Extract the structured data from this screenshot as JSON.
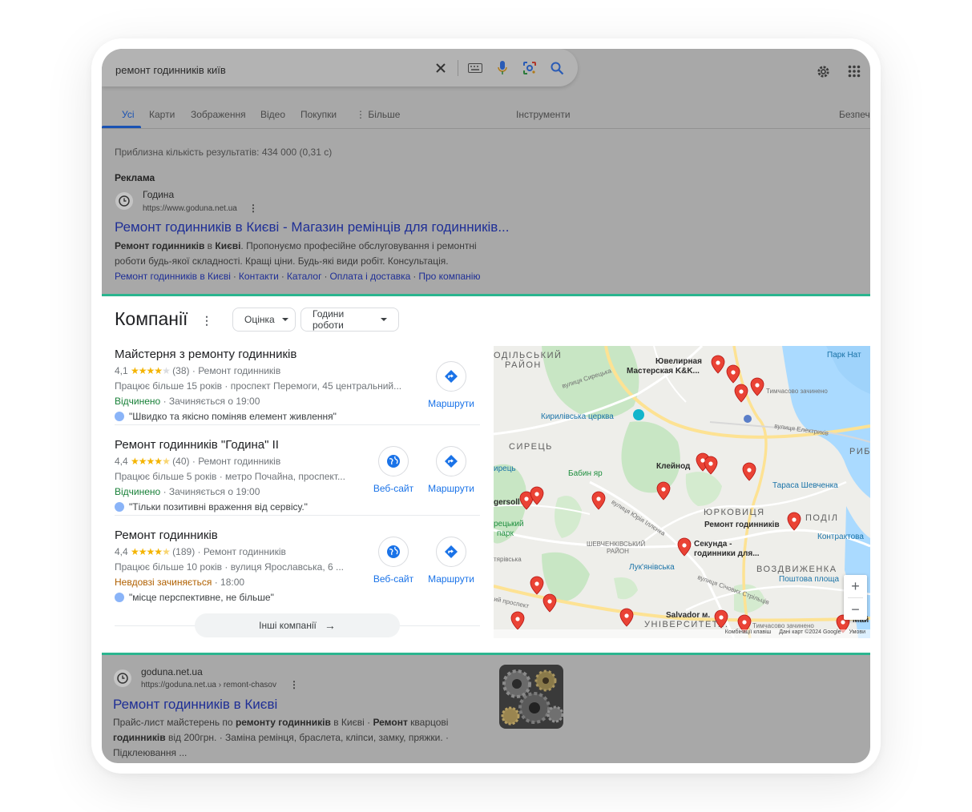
{
  "search": {
    "query": "ремонт годинників київ"
  },
  "tabs": [
    {
      "label": "Усі"
    },
    {
      "label": "Карти"
    },
    {
      "label": "Зображення"
    },
    {
      "label": "Відео"
    },
    {
      "label": "Покупки"
    },
    {
      "label": "Більше"
    },
    {
      "label": "Інструменти"
    },
    {
      "label": "Безпеч"
    }
  ],
  "result_stats": "Приблизна кількість результатів: 434 000 (0,31 с)",
  "ad": {
    "label": "Реклама",
    "site_name": "Година",
    "url": "https://www.goduna.net.ua",
    "title": "Ремонт годинників в Києві - Магазин ремінців для годинників...",
    "snippet_b1": "Ремонт годинників",
    "snippet_t1": " в ",
    "snippet_b2": "Києві",
    "snippet_t2": ". Пропонуємо професійне обслуговування і ремонтні",
    "snippet_line2": "роботи будь-якої складності. Кращі ціни. Будь-які види робіт. Консультація.",
    "sitelinks": [
      "Ремонт годинників в Києві",
      "Контакти",
      "Каталог",
      "Оплата і доставка",
      "Про компанію"
    ]
  },
  "companies": {
    "title": "Компанії",
    "filters": [
      "Оцінка",
      "Години роботи"
    ],
    "more_label": "Інші компанії",
    "items": [
      {
        "name": "Майстерня з ремонту годинників",
        "rating": "4,1",
        "stars_value": 4.1,
        "reviews": "(38)",
        "category": "Ремонт годинників",
        "details": "Працює більше 15 років · проспект Перемоги, 45 центральний...",
        "status": "Відчинено",
        "hours": " · Зачиняється о 19:00",
        "review": "\"Швидко та якісно поміняв елемент живлення\"",
        "website": "",
        "directions": "Маршрути"
      },
      {
        "name": "Ремонт годинників \"Година\" ІІ",
        "rating": "4,4",
        "stars_value": 4.4,
        "reviews": "(40)",
        "category": "Ремонт годинників",
        "details": "Працює більше 5 років · метро Почайна, проспект...",
        "status": "Відчинено",
        "hours": " · Зачиняється о 19:00",
        "review": "\"Тільки позитивні враження від сервісу.\"",
        "website": "Веб-сайт",
        "directions": "Маршрути"
      },
      {
        "name": "Ремонт годинників",
        "rating": "4,4",
        "stars_value": 4.4,
        "reviews": "(189)",
        "category": "Ремонт годинників",
        "details": "Працює більше 10 років · вулиця Ярославська, 6 ...",
        "status": "Невдовзі зачиняється",
        "hours": " · 18:00",
        "review": "\"місце перспективне, не більше\"",
        "website": "Веб-сайт",
        "directions": "Маршрути"
      }
    ]
  },
  "map": {
    "labels": {
      "podilskyi": "ОДІЛЬСЬКИЙ",
      "raion": "РАЙОН",
      "park_nat": "Парк Нат",
      "jewelry": "Ювелирная",
      "jewelry2": "Мастерская K&K...",
      "temp_closed": "Тимчасово зачинено",
      "kyrylivska": "Кирилівська церква",
      "vul_syretska": "вулиця Сирецька",
      "vul_elektrykiv": "вулиця Електриків",
      "syrets": "СИРЕЦЬ",
      "ryb": "РИБ",
      "babyn_yar": "Бабин яр",
      "kleinod": "Клейнод",
      "taras": "Тараса Шевченка",
      "yrets": "ирець",
      "gersoll": "gersoll",
      "yurkovytsia": "ЮРКОВИЦЯ",
      "podil": "ПОДІЛ",
      "remont": "Ремонт годинників",
      "kontraktova": "Контрактова",
      "park1": "рецький",
      "park2": "парк",
      "vul_yuriia": "вулиця Юрія Іллєнка",
      "shevchenkivskyi": "ШЕВЧЕНКІВСЬКИЙ",
      "raion2": "РАЙОН",
      "sekunda": "Секунда -",
      "sekunda2": "годинники для...",
      "tryivska": "тярівська",
      "lukianivska": "Лук'янівська",
      "vozdvyzhenka": "ВОЗДВИЖЕНКА",
      "poshtova": "Поштова площа",
      "prospekt": "ий проспект",
      "sichovykh": "вулиця Січових Стрільців",
      "salvador": "Salvador м.",
      "universytet": "УНІВЕРСИТЕТ...",
      "temp_closed2": "Тимчасово зачинено",
      "mai": "Май"
    },
    "footer": [
      "Комбінації клавіш",
      "Дані карт ©2024 Google",
      "Умови"
    ]
  },
  "organic": {
    "site_name": "goduna.net.ua",
    "url": "https://goduna.net.ua › remont-chasov",
    "title": "Ремонт годинників в Києві",
    "s1": "Прайс-лист майстерень по ",
    "s2": "ремонту годинників",
    "s3": " в Києві · ",
    "s4": "Ремонт",
    "s5": " кварцові",
    "s6": "годинників",
    "s7": " від 200грн. · Заміна ремінця, браслета, кліпси, замку, пряжки. ·",
    "s8": "Підклеювання ..."
  },
  "colors": {
    "link": "#1f2f96",
    "accent": "#1a73e8",
    "highlight_line": "#2bb58f",
    "pin": "#ea4335"
  }
}
